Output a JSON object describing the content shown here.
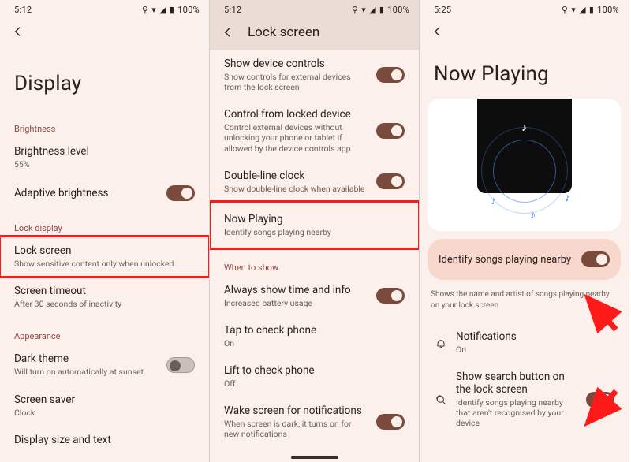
{
  "panel1": {
    "time": "5:12",
    "battery": "100%",
    "title": "Display",
    "section_brightness": "Brightness",
    "brightness_level_ttl": "Brightness level",
    "brightness_level_sub": "55%",
    "adaptive_ttl": "Adaptive brightness",
    "section_lock": "Lock display",
    "lockscreen_ttl": "Lock screen",
    "lockscreen_sub": "Show sensitive content only when unlocked",
    "timeout_ttl": "Screen timeout",
    "timeout_sub": "After 30 seconds of inactivity",
    "section_appearance": "Appearance",
    "dark_ttl": "Dark theme",
    "dark_sub": "Will turn on automatically at sunset",
    "saver_ttl": "Screen saver",
    "saver_sub": "Clock",
    "displaysize_ttl": "Display size and text"
  },
  "panel2": {
    "time": "5:12",
    "battery": "100%",
    "title": "Lock screen",
    "devctrl_ttl": "Show device controls",
    "devctrl_sub": "Show controls for external devices from the lock screen",
    "ctrllock_ttl": "Control from locked device",
    "ctrllock_sub": "Control external devices without unlocking your phone or tablet if allowed by the device controls app",
    "dbl_ttl": "Double-line clock",
    "dbl_sub": "Show double-line clock when available",
    "np_ttl": "Now Playing",
    "np_sub": "Identify songs playing nearby",
    "section_when": "When to show",
    "always_ttl": "Always show time and info",
    "always_sub": "Increased battery usage",
    "tap_ttl": "Tap to check phone",
    "tap_sub": "On",
    "lift_ttl": "Lift to check phone",
    "lift_sub": "Off",
    "wake_ttl": "Wake screen for notifications",
    "wake_sub": "When screen is dark, it turns on for new notifications"
  },
  "panel3": {
    "time": "5:25",
    "battery": "100%",
    "title": "Now Playing",
    "identify_ttl": "Identify songs playing nearby",
    "helper": "Shows the name and artist of songs playing nearby on your lock screen",
    "notif_ttl": "Notifications",
    "notif_sub": "On",
    "search_ttl": "Show search button on the lock screen",
    "search_sub": "Identify songs playing nearby that aren't recognised by your device"
  }
}
